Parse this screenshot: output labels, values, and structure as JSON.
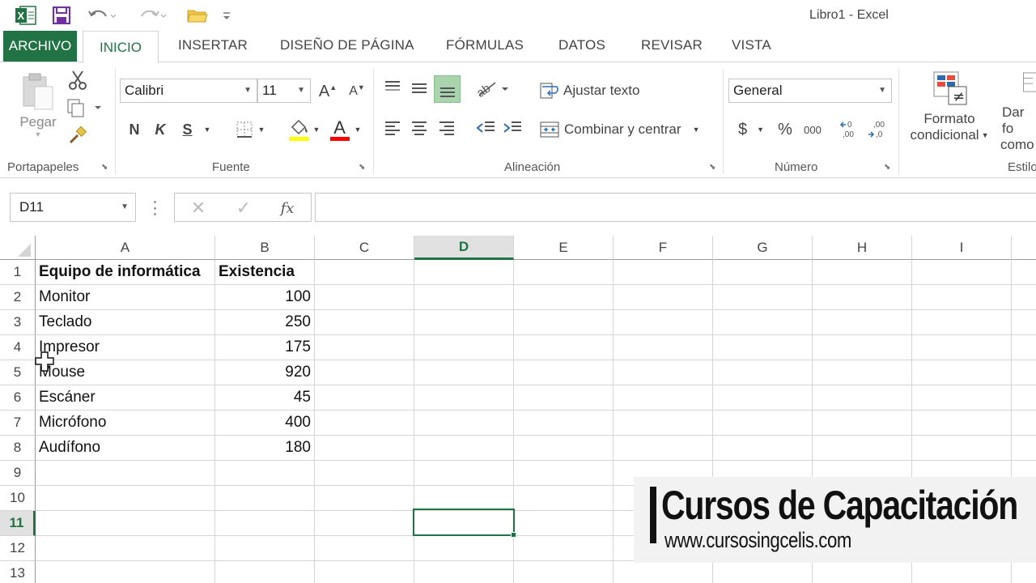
{
  "window": {
    "title": "Libro1 - Excel"
  },
  "tabs": {
    "file": "ARCHIVO",
    "home": "INICIO",
    "items": [
      "INSERTAR",
      "DISEÑO DE PÁGINA",
      "FÓRMULAS",
      "DATOS",
      "REVISAR",
      "VISTA"
    ]
  },
  "ribbon": {
    "clipboard": {
      "paste_label": "Pegar",
      "group_label": "Portapapeles"
    },
    "font": {
      "font_name": "Calibri",
      "font_size": "11",
      "bold": "N",
      "italic": "K",
      "underline": "S",
      "grow": "A",
      "shrink": "A",
      "font_color_glyph": "A",
      "group_label": "Fuente",
      "fill_color": "#ffff00",
      "text_color": "#ff0000"
    },
    "alignment": {
      "wrap_text": "Ajustar texto",
      "merge_center": "Combinar y centrar",
      "group_label": "Alineación"
    },
    "number": {
      "format": "General",
      "currency": "$",
      "percent": "%",
      "thousands": "000",
      "group_label": "Número"
    },
    "styles": {
      "conditional_line1": "Formato",
      "conditional_line2": "condicional",
      "table_line1": "Dar fo",
      "table_line2": "como",
      "group_label": "Estilo"
    }
  },
  "formula_bar": {
    "name_box": "D11",
    "fx": "fx",
    "content": ""
  },
  "sheet": {
    "columns": [
      "A",
      "B",
      "C",
      "D",
      "E",
      "F",
      "G",
      "H",
      "I"
    ],
    "active_column": "D",
    "active_row": "11",
    "rows": [
      "1",
      "2",
      "3",
      "4",
      "5",
      "6",
      "7",
      "8",
      "9",
      "10",
      "11",
      "12",
      "13"
    ],
    "header": {
      "a": "Equipo de informática",
      "b": "Existencia"
    },
    "data": [
      {
        "a": "Monitor",
        "b": "100"
      },
      {
        "a": "Teclado",
        "b": "250"
      },
      {
        "a": "Impresor",
        "b": "175"
      },
      {
        "a": "Mouse",
        "b": "920"
      },
      {
        "a": "Escáner",
        "b": "45"
      },
      {
        "a": "Micrófono",
        "b": "400"
      },
      {
        "a": "Audífono",
        "b": "180"
      }
    ],
    "accent": "#217346"
  },
  "watermark": {
    "title": "Cursos de Capacitación",
    "url": "www.cursosingcelis.com"
  }
}
